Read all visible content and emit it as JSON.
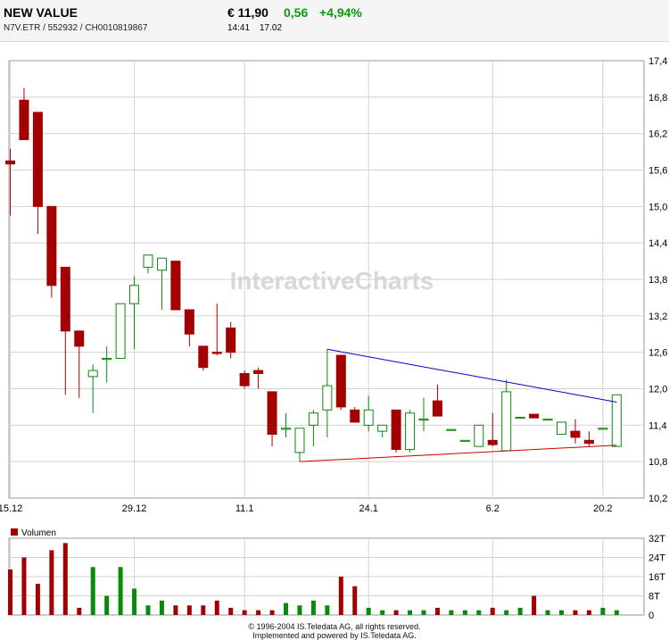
{
  "header": {
    "name": "NEW VALUE",
    "symbols": "N7V.ETR   /   552932   /   CH0010819867",
    "price": "€ 11,90",
    "change": "0,56",
    "change_pct": "+4,94%",
    "time": "14:41",
    "volume": "17.02"
  },
  "watermark": "InteractiveCharts",
  "colors": {
    "up": "#0a8a0a",
    "down": "#a50000",
    "resistance": "#0000cc",
    "support": "#cc0000"
  },
  "chart_data": {
    "type": "candlestick",
    "y_ticks": [
      "17,4",
      "16,8",
      "16,2",
      "15,6",
      "15,0",
      "14,4",
      "13,8",
      "13,2",
      "12,6",
      "12,0",
      "11,4",
      "10,8",
      "10,2"
    ],
    "ylim": [
      10.2,
      17.4
    ],
    "x_ticks": [
      {
        "label": "15.12",
        "index": 0
      },
      {
        "label": "29.12",
        "index": 9
      },
      {
        "label": "11.1",
        "index": 17
      },
      {
        "label": "24.1",
        "index": 26
      },
      {
        "label": "6.2",
        "index": 35
      },
      {
        "label": "20.2",
        "index": 43
      }
    ],
    "candles": [
      {
        "o": 15.75,
        "h": 15.95,
        "l": 14.85,
        "c": 15.7
      },
      {
        "o": 16.75,
        "h": 16.95,
        "l": 16.1,
        "c": 16.1
      },
      {
        "o": 16.55,
        "h": 16.55,
        "l": 14.55,
        "c": 15.0
      },
      {
        "o": 15.0,
        "h": 15.0,
        "l": 13.5,
        "c": 13.7
      },
      {
        "o": 14.0,
        "h": 14.0,
        "l": 11.9,
        "c": 12.95
      },
      {
        "o": 12.95,
        "h": 12.95,
        "l": 11.85,
        "c": 12.7
      },
      {
        "o": 12.2,
        "h": 12.4,
        "l": 11.6,
        "c": 12.3
      },
      {
        "o": 12.5,
        "h": 12.7,
        "l": 12.1,
        "c": 12.5
      },
      {
        "o": 12.5,
        "h": 13.4,
        "l": 12.5,
        "c": 13.4
      },
      {
        "o": 13.4,
        "h": 13.85,
        "l": 12.65,
        "c": 13.7
      },
      {
        "o": 14.0,
        "h": 14.2,
        "l": 13.9,
        "c": 14.2
      },
      {
        "o": 13.95,
        "h": 14.15,
        "l": 13.3,
        "c": 14.15
      },
      {
        "o": 14.1,
        "h": 14.1,
        "l": 13.3,
        "c": 13.3
      },
      {
        "o": 13.3,
        "h": 13.3,
        "l": 12.7,
        "c": 12.9
      },
      {
        "o": 12.7,
        "h": 12.7,
        "l": 12.3,
        "c": 12.35
      },
      {
        "o": 12.6,
        "h": 13.4,
        "l": 12.55,
        "c": 12.58
      },
      {
        "o": 13.0,
        "h": 13.1,
        "l": 12.5,
        "c": 12.6
      },
      {
        "o": 12.25,
        "h": 12.3,
        "l": 12.0,
        "c": 12.05
      },
      {
        "o": 12.3,
        "h": 12.35,
        "l": 12.0,
        "c": 12.25
      },
      {
        "o": 11.95,
        "h": 11.95,
        "l": 11.05,
        "c": 11.25
      },
      {
        "o": 11.35,
        "h": 11.6,
        "l": 11.2,
        "c": 11.35
      },
      {
        "o": 10.95,
        "h": 11.35,
        "l": 10.8,
        "c": 11.35
      },
      {
        "o": 11.4,
        "h": 11.65,
        "l": 11.05,
        "c": 11.6
      },
      {
        "o": 11.65,
        "h": 12.65,
        "l": 11.2,
        "c": 12.05
      },
      {
        "o": 12.55,
        "h": 12.55,
        "l": 11.65,
        "c": 11.7
      },
      {
        "o": 11.65,
        "h": 11.7,
        "l": 11.45,
        "c": 11.45
      },
      {
        "o": 11.4,
        "h": 11.88,
        "l": 11.3,
        "c": 11.65
      },
      {
        "o": 11.3,
        "h": 11.4,
        "l": 11.2,
        "c": 11.4
      },
      {
        "o": 11.65,
        "h": 11.65,
        "l": 10.95,
        "c": 11.0
      },
      {
        "o": 11.0,
        "h": 11.65,
        "l": 10.95,
        "c": 11.6
      },
      {
        "o": 11.5,
        "h": 11.85,
        "l": 11.3,
        "c": 11.5
      },
      {
        "o": 11.8,
        "h": 12.07,
        "l": 11.55,
        "c": 11.55
      },
      {
        "o": 11.33,
        "h": 11.33,
        "l": 11.33,
        "c": 11.33
      },
      {
        "o": 11.15,
        "h": 11.15,
        "l": 11.15,
        "c": 11.15
      },
      {
        "o": 11.05,
        "h": 11.4,
        "l": 11.05,
        "c": 11.4
      },
      {
        "o": 11.15,
        "h": 11.6,
        "l": 11.05,
        "c": 11.08
      },
      {
        "o": 10.98,
        "h": 12.15,
        "l": 10.98,
        "c": 11.95
      },
      {
        "o": 11.53,
        "h": 11.53,
        "l": 11.53,
        "c": 11.53
      },
      {
        "o": 11.58,
        "h": 11.58,
        "l": 11.52,
        "c": 11.52
      },
      {
        "o": 11.5,
        "h": 11.5,
        "l": 11.5,
        "c": 11.5
      },
      {
        "o": 11.25,
        "h": 11.45,
        "l": 11.25,
        "c": 11.45
      },
      {
        "o": 11.3,
        "h": 11.5,
        "l": 11.1,
        "c": 11.2
      },
      {
        "o": 11.15,
        "h": 11.3,
        "l": 11.05,
        "c": 11.1
      },
      {
        "o": 11.35,
        "h": 11.35,
        "l": 11.35,
        "c": 11.35
      },
      {
        "o": 11.05,
        "h": 11.9,
        "l": 11.05,
        "c": 11.9
      }
    ],
    "trendlines": [
      {
        "name": "resistance",
        "from": {
          "index": 23,
          "y": 12.65
        },
        "to": {
          "index": 44,
          "y": 11.78
        }
      },
      {
        "name": "support",
        "from": {
          "index": 21,
          "y": 10.8
        },
        "to": {
          "index": 44,
          "y": 11.07
        }
      }
    ],
    "volume": {
      "label": "Volumen",
      "y_ticks": [
        "32T",
        "24T",
        "16T",
        "8T",
        "0"
      ],
      "ylim": [
        0,
        32
      ],
      "values": [
        19,
        24,
        13,
        27,
        30,
        3,
        20,
        8,
        20,
        11,
        4,
        6,
        4,
        4,
        4,
        6,
        3,
        2,
        2,
        2,
        5,
        4,
        6,
        4,
        16,
        12,
        3,
        2,
        2,
        2,
        2,
        3,
        2,
        2,
        2,
        3,
        2,
        3,
        8,
        2,
        2,
        2,
        2,
        3,
        2
      ]
    }
  },
  "footer": {
    "line1": "© 1996-2004 IS.Teledata AG, all rights reserved.",
    "line2": "Implemented and powered by IS.Teledata AG."
  }
}
